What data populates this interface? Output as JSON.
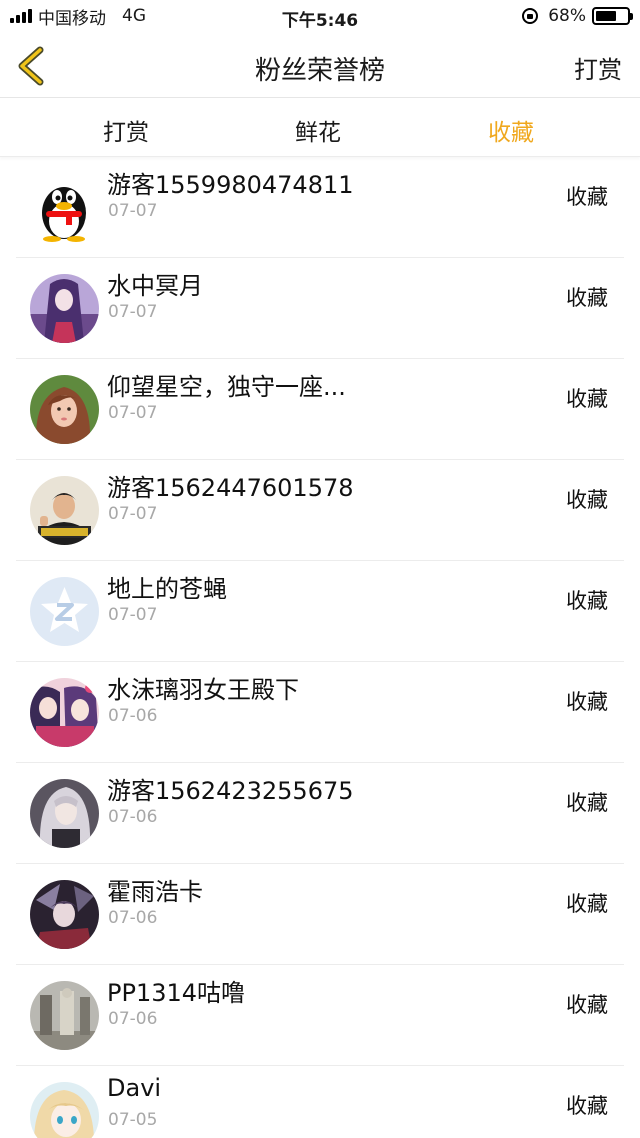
{
  "status_bar": {
    "carrier": "中国移动",
    "network": "4G",
    "time": "下午5:46",
    "battery": "68%",
    "battery_level": 0.68
  },
  "nav": {
    "title": "粉丝荣誉榜",
    "action_label": "打赏",
    "back_icon": "chevron-left-icon",
    "accent_color": "#f0a81e"
  },
  "tabs": [
    {
      "label": "打赏",
      "active": false
    },
    {
      "label": "鲜花",
      "active": false
    },
    {
      "label": "收藏",
      "active": true
    }
  ],
  "fans": [
    {
      "name": "游客1559980474811",
      "date": "07-07",
      "action": "收藏",
      "avatar": "qq-penguin-avatar"
    },
    {
      "name": "水中冥月",
      "date": "07-07",
      "action": "收藏",
      "avatar": "anime-girl-purple-avatar"
    },
    {
      "name": "仰望星空，独守一座...",
      "date": "07-07",
      "action": "收藏",
      "avatar": "girl-photo-avatar"
    },
    {
      "name": "游客1562447601578",
      "date": "07-07",
      "action": "收藏",
      "avatar": "man-photo-avatar"
    },
    {
      "name": "地上的苍蝇",
      "date": "07-07",
      "action": "收藏",
      "avatar": "default-star-avatar"
    },
    {
      "name": "水沫璃羽女王殿下",
      "date": "07-06",
      "action": "收藏",
      "avatar": "anime-pair-avatar"
    },
    {
      "name": "游客1562423255675",
      "date": "07-06",
      "action": "收藏",
      "avatar": "anime-silver-hair-avatar"
    },
    {
      "name": "霍雨浩卡",
      "date": "07-06",
      "action": "收藏",
      "avatar": "anime-dark-avatar"
    },
    {
      "name": "PP1314咕噜",
      "date": "07-06",
      "action": "收藏",
      "avatar": "statue-photo-avatar"
    },
    {
      "name": "Davi",
      "date": "07-05",
      "action": "收藏",
      "avatar": "anime-blonde-avatar"
    }
  ]
}
